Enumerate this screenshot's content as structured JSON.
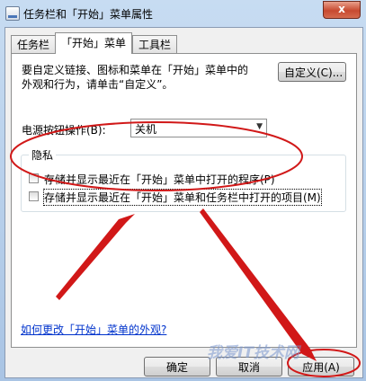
{
  "window": {
    "title": "任务栏和「开始」菜单属性",
    "close_glyph": "x"
  },
  "tabs": [
    {
      "label": "任务栏",
      "active": false
    },
    {
      "label": "「开始」菜单",
      "active": true
    },
    {
      "label": "工具栏",
      "active": false
    }
  ],
  "start_menu": {
    "description_line1": "要自定义链接、图标和菜单在「开始」菜单中的",
    "description_line2": "外观和行为，请单击“自定义”。",
    "customize_button": "自定义(C)...",
    "power_label": "电源按钮操作(B):",
    "power_value": "关机",
    "privacy": {
      "label": "隐私",
      "option1": "存储并显示最近在「开始」菜单中打开的程序(P)",
      "option2": "存储并显示最近在「开始」菜单和任务栏中打开的项目(M)"
    },
    "help_link": "如何更改「开始」菜单的外观?"
  },
  "buttons": {
    "ok": "确定",
    "cancel": "取消",
    "apply": "应用(A)"
  },
  "watermark": "我爱IT技术网",
  "colors": {
    "annotation": "#d11818",
    "link": "#0033cc"
  }
}
